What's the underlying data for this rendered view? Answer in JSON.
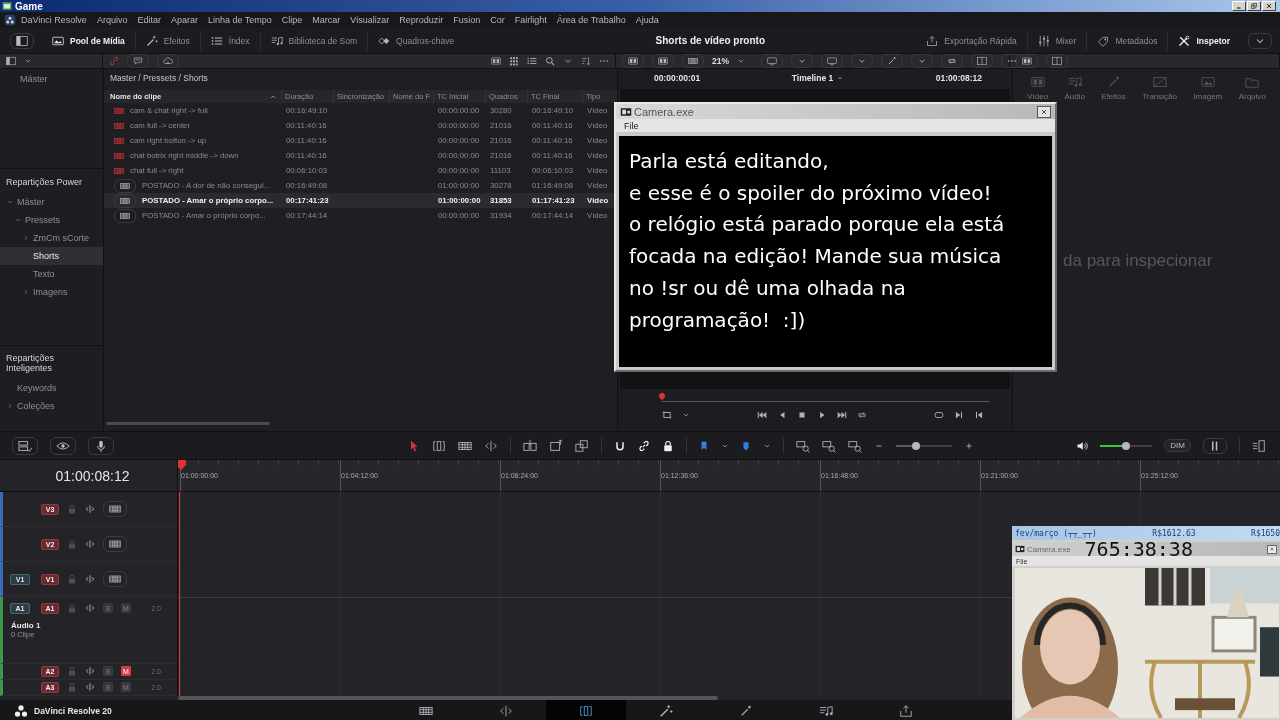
{
  "window": {
    "title": "Game"
  },
  "menu": [
    "DaVinci Resolve",
    "Arquivo",
    "Editar",
    "Aparar",
    "Linha de Tempo",
    "Clipe",
    "Marcar",
    "Visualizar",
    "Reproduzir",
    "Fusion",
    "Cor",
    "Fairlight",
    "Área de Trabalho",
    "Ajuda"
  ],
  "toolbar": {
    "left": [
      {
        "label": "Pool de Mídia",
        "selected": true
      },
      {
        "label": "Efeitos",
        "selected": false
      },
      {
        "label": "Índex",
        "selected": false
      },
      {
        "label": "Biblioteca de Som",
        "selected": false
      },
      {
        "label": "Quadros-chave",
        "selected": false
      }
    ],
    "title": "Shorts de vídeo pronto",
    "right": [
      {
        "label": "Exportação Rápida",
        "selected": false
      },
      {
        "label": "Mixer",
        "selected": false
      },
      {
        "label": "Metadados",
        "selected": false
      },
      {
        "label": "Inspetor",
        "selected": true
      }
    ]
  },
  "viewer_zoom": "21%",
  "sidebar": {
    "top_item": "Máster",
    "sections": [
      {
        "title": "Repartições Power",
        "items": [
          {
            "label": "Máster",
            "kind": "group",
            "expanded": true,
            "selected": false,
            "children": [
              {
                "label": "Pressets",
                "kind": "group",
                "expanded": true,
                "selected": false,
                "children": [
                  {
                    "label": "ZmCm sCorte",
                    "kind": "group",
                    "expanded": false,
                    "selected": false
                  },
                  {
                    "label": "Shorts",
                    "kind": "leaf",
                    "selected": true
                  },
                  {
                    "label": "Texto",
                    "kind": "leaf",
                    "selected": false
                  },
                  {
                    "label": "Imagens",
                    "kind": "group",
                    "expanded": false,
                    "selected": false
                  }
                ]
              }
            ]
          }
        ]
      },
      {
        "title": "Repartições Inteligentes",
        "items": [
          {
            "label": "Keywords",
            "kind": "leaf",
            "selected": false
          },
          {
            "label": "Coleções",
            "kind": "group",
            "expanded": false,
            "selected": false
          }
        ]
      }
    ]
  },
  "media_pool": {
    "path": "Master / Pressets / Shorts",
    "columns": [
      {
        "label": "Nome do clipe",
        "sorted": true
      },
      {
        "label": "Duração",
        "sorted": false
      },
      {
        "label": "Sincronização",
        "sorted": false
      },
      {
        "label": "Nome do F",
        "sorted": false
      },
      {
        "label": "TC Inicial",
        "sorted": false
      },
      {
        "label": "Quadros",
        "sorted": false
      },
      {
        "label": "TC Final",
        "sorted": false
      },
      {
        "label": "Tipo",
        "sorted": false
      }
    ],
    "rows": [
      {
        "kind": "preset",
        "selected": false,
        "name": "cam & chat right -> full",
        "duration": "00:16:49:10",
        "tc_start": "00:00:00:00",
        "frames": "30280",
        "tc_end": "00:16:49:10",
        "type": "Vídeo"
      },
      {
        "kind": "preset",
        "selected": false,
        "name": "cam full -> center",
        "duration": "00:11:40:16",
        "tc_start": "00:00:00:00",
        "frames": "21016",
        "tc_end": "00:11:40:16",
        "type": "Vídeo"
      },
      {
        "kind": "preset",
        "selected": false,
        "name": "cam right botton -> up",
        "duration": "00:11:40:16",
        "tc_start": "00:00:00:00",
        "frames": "21016",
        "tc_end": "00:11:40:16",
        "type": "Vídeo"
      },
      {
        "kind": "preset",
        "selected": false,
        "name": "chat botrix right middle -> down",
        "duration": "00:11:40:16",
        "tc_start": "00:00:00:00",
        "frames": "21016",
        "tc_end": "00:11:40:16",
        "type": "Vídeo"
      },
      {
        "kind": "preset",
        "selected": false,
        "name": "chat full -> right",
        "duration": "00:06:10:03",
        "tc_start": "00:00:00:00",
        "frames": "11103",
        "tc_end": "00:06:10:03",
        "type": "Vídeo"
      },
      {
        "kind": "clip",
        "selected": false,
        "name": "POSTADO - A dor de não consegui...",
        "duration": "00:16:49:08",
        "tc_start": "01:00:00:00",
        "frames": "30278",
        "tc_end": "01:16:49:08",
        "type": "Vídeo"
      },
      {
        "kind": "clip",
        "selected": true,
        "name": "POSTADO - Amar o próprio corpo...",
        "duration": "00:17:41:23",
        "tc_start": "01:00:00:00",
        "frames": "31853",
        "tc_end": "01:17:41:23",
        "type": "Vídeo"
      },
      {
        "kind": "clip",
        "selected": false,
        "name": "POSTADO - Amar o próprio corpo...",
        "duration": "00:17:44:14",
        "tc_start": "00:00:00:00",
        "frames": "31934",
        "tc_end": "00:17:44:14",
        "type": "Vídeo"
      }
    ]
  },
  "viewer": {
    "timecode": "00:00:00:01",
    "timeline": "Timeline 1",
    "duration": "01:00:08:12"
  },
  "inspector": {
    "tabs": [
      {
        "label": "Vídeo",
        "disabled": true
      },
      {
        "label": "Áudio",
        "disabled": true
      },
      {
        "label": "Efeitos",
        "disabled": true
      },
      {
        "label": "Transição",
        "disabled": true
      },
      {
        "label": "Imagem",
        "disabled": true
      },
      {
        "label": "Arquivo",
        "disabled": true
      }
    ],
    "message": "da para inspecionar"
  },
  "timeline_toolbar": {
    "zoom": {
      "level": 0.35
    },
    "volume": {
      "level": 0.5
    },
    "dim": "DIM"
  },
  "timeline": {
    "timecode": "01:00:08:12",
    "ruler": [
      "01:00:00:00",
      "01:04:12:00",
      "01:08:24:00",
      "01:12:36:00",
      "01:16:48:00",
      "01:21:00:00",
      "01:25:12:00"
    ],
    "tracks": [
      {
        "kind": "video",
        "label": "V3"
      },
      {
        "kind": "video",
        "label": "V2"
      },
      {
        "kind": "video",
        "label": "V1",
        "source": "V1"
      },
      {
        "kind": "audio",
        "label": "A1",
        "source": "A1",
        "name": "Áudio 1",
        "clips": "0 Clipe",
        "solo": "S",
        "soloed": false,
        "mute": "M",
        "muted": false,
        "channels": "2.0"
      },
      {
        "kind": "audio",
        "label": "A2",
        "solo": "S",
        "soloed": false,
        "mute": "M",
        "muted": true,
        "channels": "2.0"
      },
      {
        "kind": "audio",
        "label": "A3",
        "solo": "S",
        "soloed": false,
        "mute": "M",
        "muted": false,
        "channels": "2.0"
      }
    ]
  },
  "page_bar": {
    "app": "DaVinci Resolve 20",
    "pages": [
      {
        "selected": false
      },
      {
        "selected": false
      },
      {
        "selected": true
      },
      {
        "selected": false
      },
      {
        "selected": false
      },
      {
        "selected": false
      },
      {
        "selected": false
      }
    ]
  },
  "camera_window": {
    "title": "Camera.exe",
    "menu": [
      "File"
    ],
    "lines": [
      "Parla está editando,",
      "e esse é o spoiler do próximo vídeo!",
      "o relógio está parado porque ela está",
      "focada na edição! Mande sua música",
      "no !sr ou dê uma olhada na",
      "programação!  :])"
    ]
  },
  "webcam_overlay": {
    "header": [
      "fev/março (┬┬_┬┬)",
      "R$1612.63",
      "R$1650"
    ],
    "title": "Camera.exe",
    "timer": "765:38:38",
    "menu": [
      "File"
    ],
    "photo": {
      "kind": "picture"
    }
  }
}
